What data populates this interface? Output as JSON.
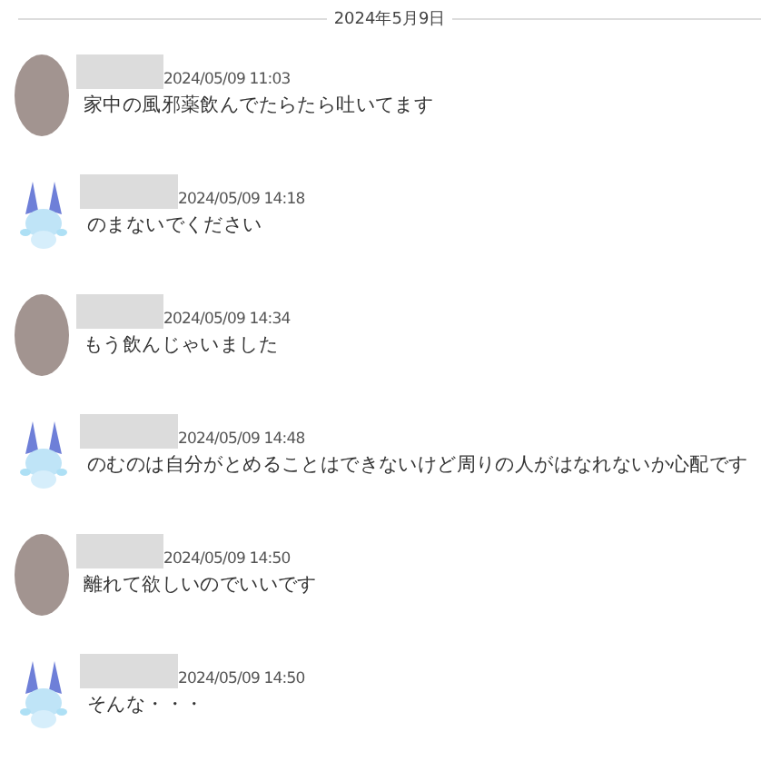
{
  "date_divider": "2024年5月9日",
  "messages": [
    {
      "kind": "user",
      "time": "2024/05/09 11:03",
      "text": "家中の風邪薬飲んでたらたら吐いてます"
    },
    {
      "kind": "character",
      "time": "2024/05/09 14:18",
      "text": "のまないでください"
    },
    {
      "kind": "user",
      "time": "2024/05/09 14:34",
      "text": "もう飲んじゃいました"
    },
    {
      "kind": "character",
      "time": "2024/05/09 14:48",
      "text": "のむのは自分がとめることはできないけど周りの人がはなれないか心配です"
    },
    {
      "kind": "user",
      "time": "2024/05/09 14:50",
      "text": "離れて欲しいのでいいです"
    },
    {
      "kind": "character",
      "time": "2024/05/09 14:50",
      "text": "そんな・・・"
    }
  ]
}
